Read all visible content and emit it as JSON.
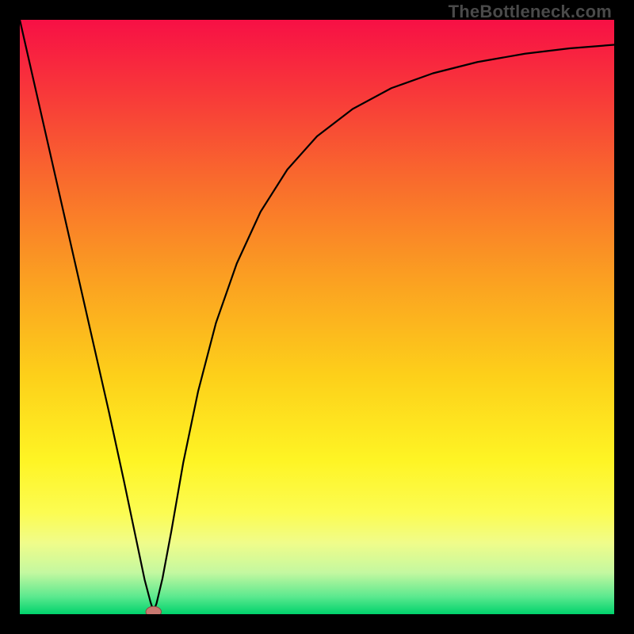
{
  "watermark": "TheBottleneck.com",
  "chart_data": {
    "type": "line",
    "title": "",
    "xlabel": "",
    "ylabel": "",
    "xlim": [
      0,
      1
    ],
    "ylim": [
      0,
      1
    ],
    "grid": false,
    "legend": false,
    "background_gradient": {
      "stops": [
        {
          "offset": 0.0,
          "color": "#f71045"
        },
        {
          "offset": 0.12,
          "color": "#f8373a"
        },
        {
          "offset": 0.28,
          "color": "#f96e2c"
        },
        {
          "offset": 0.44,
          "color": "#fba121"
        },
        {
          "offset": 0.6,
          "color": "#fdd01a"
        },
        {
          "offset": 0.74,
          "color": "#fef424"
        },
        {
          "offset": 0.83,
          "color": "#fcfc52"
        },
        {
          "offset": 0.88,
          "color": "#f0fc8a"
        },
        {
          "offset": 0.93,
          "color": "#c4f8a0"
        },
        {
          "offset": 0.97,
          "color": "#5de98f"
        },
        {
          "offset": 1.0,
          "color": "#00d36c"
        }
      ]
    },
    "series": [
      {
        "name": "curve",
        "x": [
          0.0,
          0.025,
          0.05,
          0.075,
          0.1,
          0.125,
          0.15,
          0.175,
          0.197,
          0.21,
          0.22,
          0.225,
          0.23,
          0.24,
          0.255,
          0.275,
          0.3,
          0.33,
          0.365,
          0.405,
          0.45,
          0.5,
          0.56,
          0.625,
          0.695,
          0.77,
          0.85,
          0.925,
          1.0
        ],
        "y": [
          1.0,
          0.89,
          0.78,
          0.67,
          0.56,
          0.45,
          0.34,
          0.225,
          0.12,
          0.058,
          0.02,
          0.005,
          0.018,
          0.06,
          0.14,
          0.255,
          0.375,
          0.49,
          0.59,
          0.677,
          0.748,
          0.804,
          0.85,
          0.885,
          0.91,
          0.929,
          0.943,
          0.952,
          0.958
        ]
      }
    ],
    "marker": {
      "cx": 0.225,
      "cy": 0.004,
      "rx": 0.013,
      "ry": 0.009,
      "fill": "#c87870",
      "stroke": "#8c4a42"
    }
  }
}
